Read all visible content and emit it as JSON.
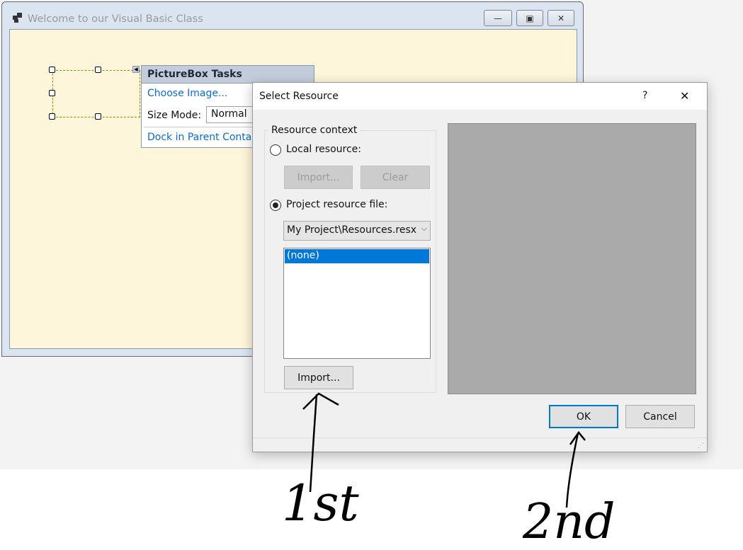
{
  "window": {
    "title": "Welcome to our Visual Basic Class",
    "minimize": "—",
    "maximize": "▣",
    "close": "✕"
  },
  "tasks": {
    "title": "PictureBox Tasks",
    "choose_image": "Choose Image...",
    "size_mode_label": "Size Mode:",
    "size_mode_value": "Normal",
    "dock": "Dock in Parent Container"
  },
  "dialog": {
    "title": "Select Resource",
    "help": "?",
    "close": "✕",
    "group_label": "Resource context",
    "local_label": "Local resource:",
    "local_import": "Import...",
    "local_clear": "Clear",
    "project_label": "Project resource file:",
    "project_file": "My Project\\Resources.resx",
    "resources": [
      "(none)"
    ],
    "import": "Import...",
    "ok": "OK",
    "cancel": "Cancel"
  },
  "annotations": {
    "first": "1st",
    "second": "2nd"
  },
  "colors": {
    "selection": "#0078d7",
    "preview": "#aaaaaa",
    "client": "#fef6da"
  }
}
